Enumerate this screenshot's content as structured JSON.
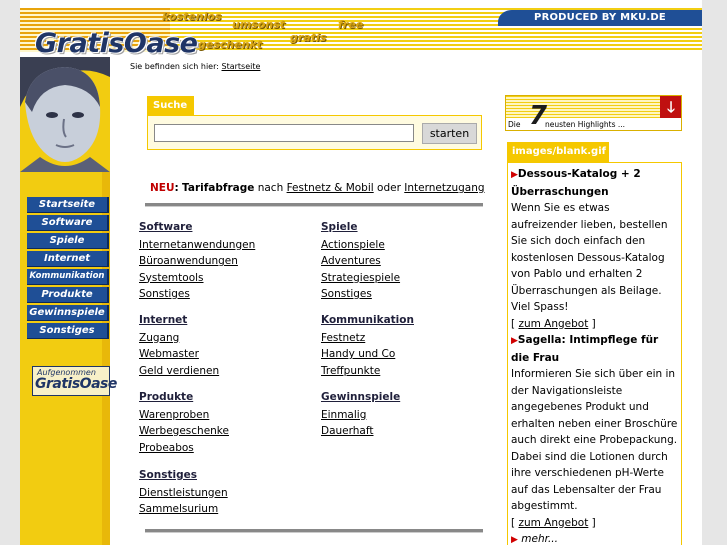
{
  "header": {
    "produced_by": "PRODUCED BY MKU.DE",
    "logo": "GratisOase",
    "header_words": [
      "kostenlos",
      "umsonst",
      "free",
      "gratis",
      "geschenkt"
    ]
  },
  "breadcrumb": {
    "prefix": "Sie befinden sich hier:",
    "link": "Startseite"
  },
  "nav": [
    "Startseite",
    "Software",
    "Spiele",
    "Internet",
    "Kommunikation",
    "Produkte",
    "Gewinnspiele",
    "Sonstiges"
  ],
  "badge": {
    "top": "Aufgenommen",
    "logo": "GratisOase"
  },
  "search": {
    "title": "Suche",
    "value": "",
    "button": "starten"
  },
  "news": {
    "tag": "NEU",
    "colon": ":",
    "bold": "Tarifabfrage",
    "text1": "nach",
    "link1": "Festnetz & Mobil",
    "text2": "oder",
    "link2": "Internetzugang"
  },
  "categories_left": [
    {
      "title": "Software",
      "links": [
        "Internetanwendungen",
        "Büroanwendungen",
        "Systemtools",
        "Sonstiges"
      ]
    },
    {
      "title": "Internet",
      "links": [
        "Zugang",
        "Webmaster",
        "Geld verdienen"
      ]
    },
    {
      "title": "Produkte",
      "links": [
        "Warenproben",
        "Werbegeschenke",
        "Probeabos"
      ]
    },
    {
      "title": "Sonstiges",
      "links": [
        "Dienstleistungen",
        "Sammelsurium"
      ]
    }
  ],
  "categories_right": [
    {
      "title": "Spiele",
      "links": [
        "Actionspiele",
        "Adventures",
        "Strategiespiele",
        "Sonstiges"
      ]
    },
    {
      "title": "Kommunikation",
      "links": [
        "Festnetz",
        "Handy und Co",
        "Treffpunkte"
      ]
    },
    {
      "title": "Gewinnspiele",
      "links": [
        "Einmalig",
        "Dauerhaft"
      ]
    }
  ],
  "highlights": {
    "prefix": "Die",
    "number": "7",
    "suffix": "neusten Highlights ...",
    "arrow": "🡓"
  },
  "ad": {
    "tab": "images/blank.gif",
    "items": [
      {
        "title": "Dessous-Katalog + 2 Überraschungen",
        "text": "Wenn Sie es etwas aufreizender lieben, bestellen Sie sich doch einfach den kostenlosen Dessous-Katalog von Pablo und erhalten 2 Überraschungen als Beilage. Viel Spass!",
        "link": "zum Angebot"
      },
      {
        "title": "Sagella: Intimpflege für die Frau",
        "text": "Informieren Sie sich über ein in der Navigationsleiste angegebenes Produkt und erhalten neben einer Broschüre auch direkt eine Probepackung. Dabei sind die Lotionen durch ihre verschiedenen pH-Werte auf das Lebensalter der Frau abgestimmt.",
        "link": "zum Angebot"
      }
    ],
    "more": "mehr..."
  }
}
